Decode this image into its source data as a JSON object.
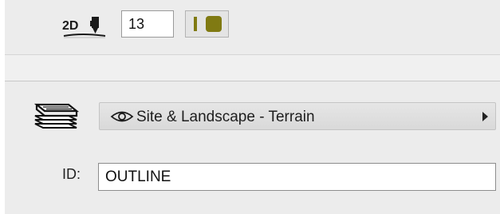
{
  "pen": {
    "mode_label": "2D",
    "number": "13",
    "color": "#807a12"
  },
  "layer": {
    "visibility_icon": "eye-icon",
    "name": "Site & Landscape - Terrain",
    "menu_icon": "chevron-right-icon"
  },
  "id": {
    "label": "ID:",
    "value": "OUTLINE"
  }
}
